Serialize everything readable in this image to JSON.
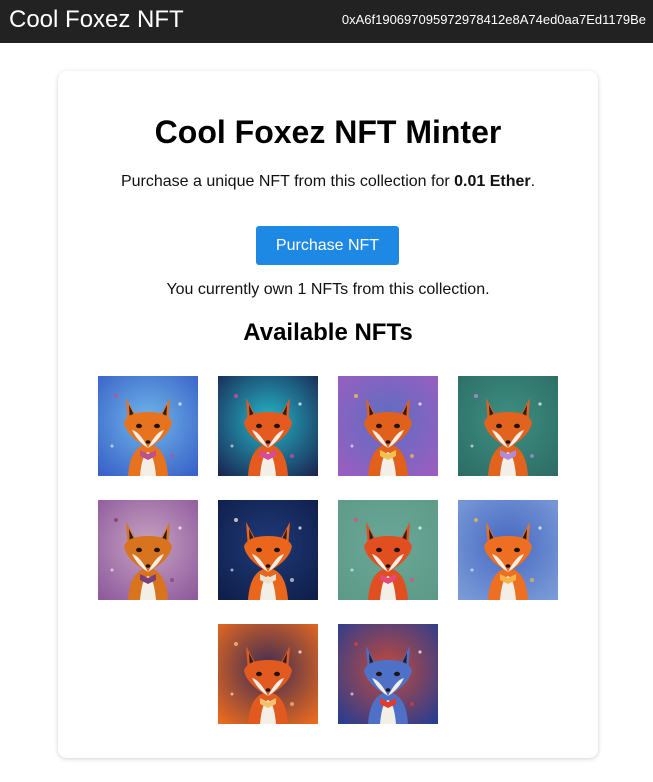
{
  "header": {
    "title": "Cool Foxez NFT",
    "wallet_address": "0xA6f190697095972978412e8A74ed0aa7Ed1179Be"
  },
  "minter": {
    "title": "Cool Foxez NFT Minter",
    "price_prefix": "Purchase a unique NFT from this collection for ",
    "price_value": "0.01 Ether",
    "price_suffix": ".",
    "purchase_label": "Purchase NFT",
    "ownership_text": "You currently own 1 NFTs from this collection."
  },
  "gallery": {
    "title": "Available NFTs",
    "items": [
      {
        "name": "fox-with-sunglasses-and-bowtie",
        "bg": "#6fb6e8",
        "bg2": "#3a62c9",
        "fur": "#e8731f",
        "accent": "#c0508a"
      },
      {
        "name": "fox-with-radiating-lines",
        "bg": "#25b7c9",
        "bg2": "#1a2a55",
        "fur": "#e55a1f",
        "accent": "#d94a9a"
      },
      {
        "name": "sitting-fox-in-portal",
        "bg": "#5c6ec2",
        "bg2": "#9a5ec0",
        "fur": "#e0601c",
        "accent": "#f2c14e"
      },
      {
        "name": "fox-face-with-flowers",
        "bg": "#3e8f83",
        "bg2": "#2d6e66",
        "fur": "#e2631e",
        "accent": "#b48ad8"
      },
      {
        "name": "long-haired-fox-portrait",
        "bg": "#c7a3c0",
        "bg2": "#8f5b9e",
        "fur": "#d8731e",
        "accent": "#7a3f7a"
      },
      {
        "name": "fox-in-space",
        "bg": "#1f3a7a",
        "bg2": "#0f1f4a",
        "fur": "#e9661c",
        "accent": "#e8e3cf"
      },
      {
        "name": "fox-with-pink-triangle",
        "bg": "#6aa796",
        "bg2": "#5d9a88",
        "fur": "#e14e1f",
        "accent": "#e34a7a"
      },
      {
        "name": "blue-glow-fox",
        "bg": "#4668c0",
        "bg2": "#7a9bd8",
        "fur": "#ef6f22",
        "accent": "#f7b24a"
      },
      {
        "name": "fox-in-suit",
        "bg": "#3c2b55",
        "bg2": "#e86a1e",
        "fur": "#e25a20",
        "accent": "#f4c070"
      },
      {
        "name": "blue-fox-with-red-sunglasses",
        "bg": "#c34a3a",
        "bg2": "#2a3d8f",
        "fur": "#4f70c7",
        "accent": "#e23b2c"
      }
    ]
  }
}
